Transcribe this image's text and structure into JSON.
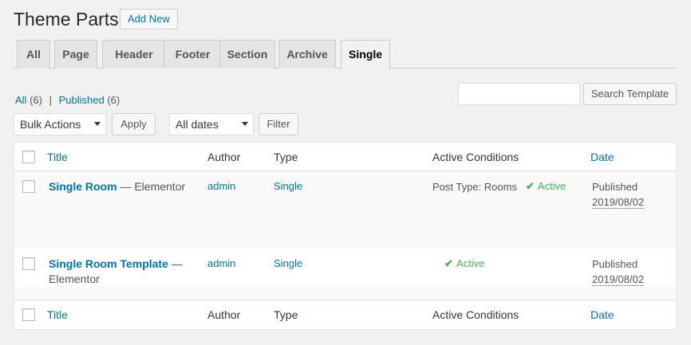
{
  "header": {
    "title": "Theme Parts",
    "add_new": "Add New"
  },
  "tabs": [
    "All",
    "Page",
    "Header",
    "Footer",
    "Section",
    "Archive",
    "Single"
  ],
  "filters": {
    "all_label": "All",
    "all_count": "(6)",
    "separator": "|",
    "published_label": "Published",
    "published_count": "(6)"
  },
  "search": {
    "button": "Search Template",
    "value": ""
  },
  "tablenav": {
    "bulk_actions": "Bulk Actions",
    "apply": "Apply",
    "dates": "All dates",
    "filter": "Filter"
  },
  "table": {
    "columns": {
      "title": "Title",
      "author": "Author",
      "type": "Type",
      "conditions": "Active Conditions",
      "date": "Date"
    },
    "rows": [
      {
        "title": "Single Room",
        "suffix": "— Elementor",
        "author": "admin",
        "type": "Single",
        "condition": "Post Type: Rooms",
        "status_icon": "✔",
        "status": "Active",
        "date_status": "Published",
        "date": "2019/08/02"
      },
      {
        "title": "Single Room Template",
        "suffix": "—",
        "suffix2": "Elementor",
        "author": "admin",
        "type": "Single",
        "condition": "",
        "status_icon": "✔",
        "status": "Active",
        "date_status": "Published",
        "date": "2019/08/02"
      }
    ]
  },
  "colors": {
    "link": "#0073aa",
    "active": "#46b450",
    "background": "#f1f1f1"
  },
  "icons": {
    "checkmark": "checkmark-icon",
    "dropdown": "chevron-down-icon"
  }
}
